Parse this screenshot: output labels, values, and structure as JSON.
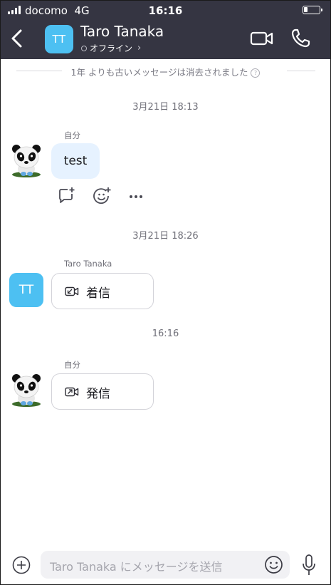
{
  "status_bar": {
    "carrier": "docomo",
    "network": "4G",
    "time": "16:16"
  },
  "header": {
    "avatar_initials": "TT",
    "contact_name": "Taro Tanaka",
    "presence": "オフライン",
    "presence_chevron": "›",
    "accent_color": "#353542",
    "avatar_color": "#4dc0f2"
  },
  "notice": {
    "text": "1年 よりも古いメッセージは消去されました",
    "info_icon": "?"
  },
  "messages": [
    {
      "date": "3月21日 18:13",
      "sender": "自分",
      "text": "test"
    },
    {
      "date": "3月21日 18:26",
      "sender": "Taro Tanaka",
      "avatar_initials": "TT",
      "call_label": "着信"
    },
    {
      "date": "16:16",
      "sender": "自分",
      "call_label": "発信"
    }
  ],
  "message_actions": [
    "reply-thread-icon",
    "add-reaction-icon",
    "more-icon"
  ],
  "composer": {
    "placeholder": "Taro Tanaka にメッセージを送信"
  }
}
